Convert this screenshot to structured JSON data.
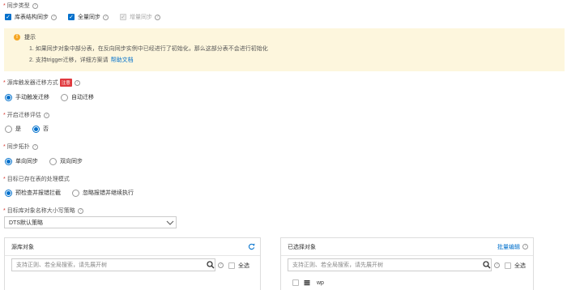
{
  "sync_type": {
    "label": "同步类型",
    "options": [
      {
        "label": "库表结构同步",
        "checked": true,
        "disabled": false
      },
      {
        "label": "全量同步",
        "checked": true,
        "disabled": false
      },
      {
        "label": "增量同步",
        "checked": true,
        "disabled": true
      }
    ]
  },
  "tip": {
    "title": "提示",
    "line1": "1. 如果同步对象中部分表，在反向同步实例中已经进行了初始化，那么这部分表不会进行初始化",
    "line2_prefix": "2. 支持trigger迁移，详细方案请",
    "line2_link": "帮助文档"
  },
  "trigger_mode": {
    "label": "源库触发器迁移方式",
    "badge": "注意",
    "options": [
      {
        "label": "手动触发迁移",
        "selected": true
      },
      {
        "label": "自动迁移",
        "selected": false
      }
    ]
  },
  "migration_eval": {
    "label": "开启迁移评估",
    "options": [
      {
        "label": "是",
        "selected": false
      },
      {
        "label": "否",
        "selected": true
      }
    ]
  },
  "topology": {
    "label": "同步拓扑",
    "options": [
      {
        "label": "单向同步",
        "selected": true
      },
      {
        "label": "双向同步",
        "selected": false
      }
    ]
  },
  "existing_table": {
    "label": "目标已存在表的处理模式",
    "options": [
      {
        "label": "预检查并报错拦截",
        "selected": true
      },
      {
        "label": "忽略报错并继续执行",
        "selected": false
      }
    ]
  },
  "case_policy": {
    "label": "目标库对象名称大小写策略",
    "value": "DTS默认策略"
  },
  "source_panel": {
    "title": "源库对象",
    "search_placeholder": "支持正则、若全局搜索，请先展开树",
    "select_all": "全选"
  },
  "selected_panel": {
    "title": "已选择对象",
    "batch_edit": "批量编辑",
    "search_placeholder": "支持正则、若全局搜索，请先展开树",
    "select_all": "全选",
    "items": [
      "wp"
    ]
  },
  "colors": {
    "primary": "#0070cc",
    "warning_bg": "#fdf6dd",
    "required": "#d9342b",
    "badge": "#e0393e"
  }
}
